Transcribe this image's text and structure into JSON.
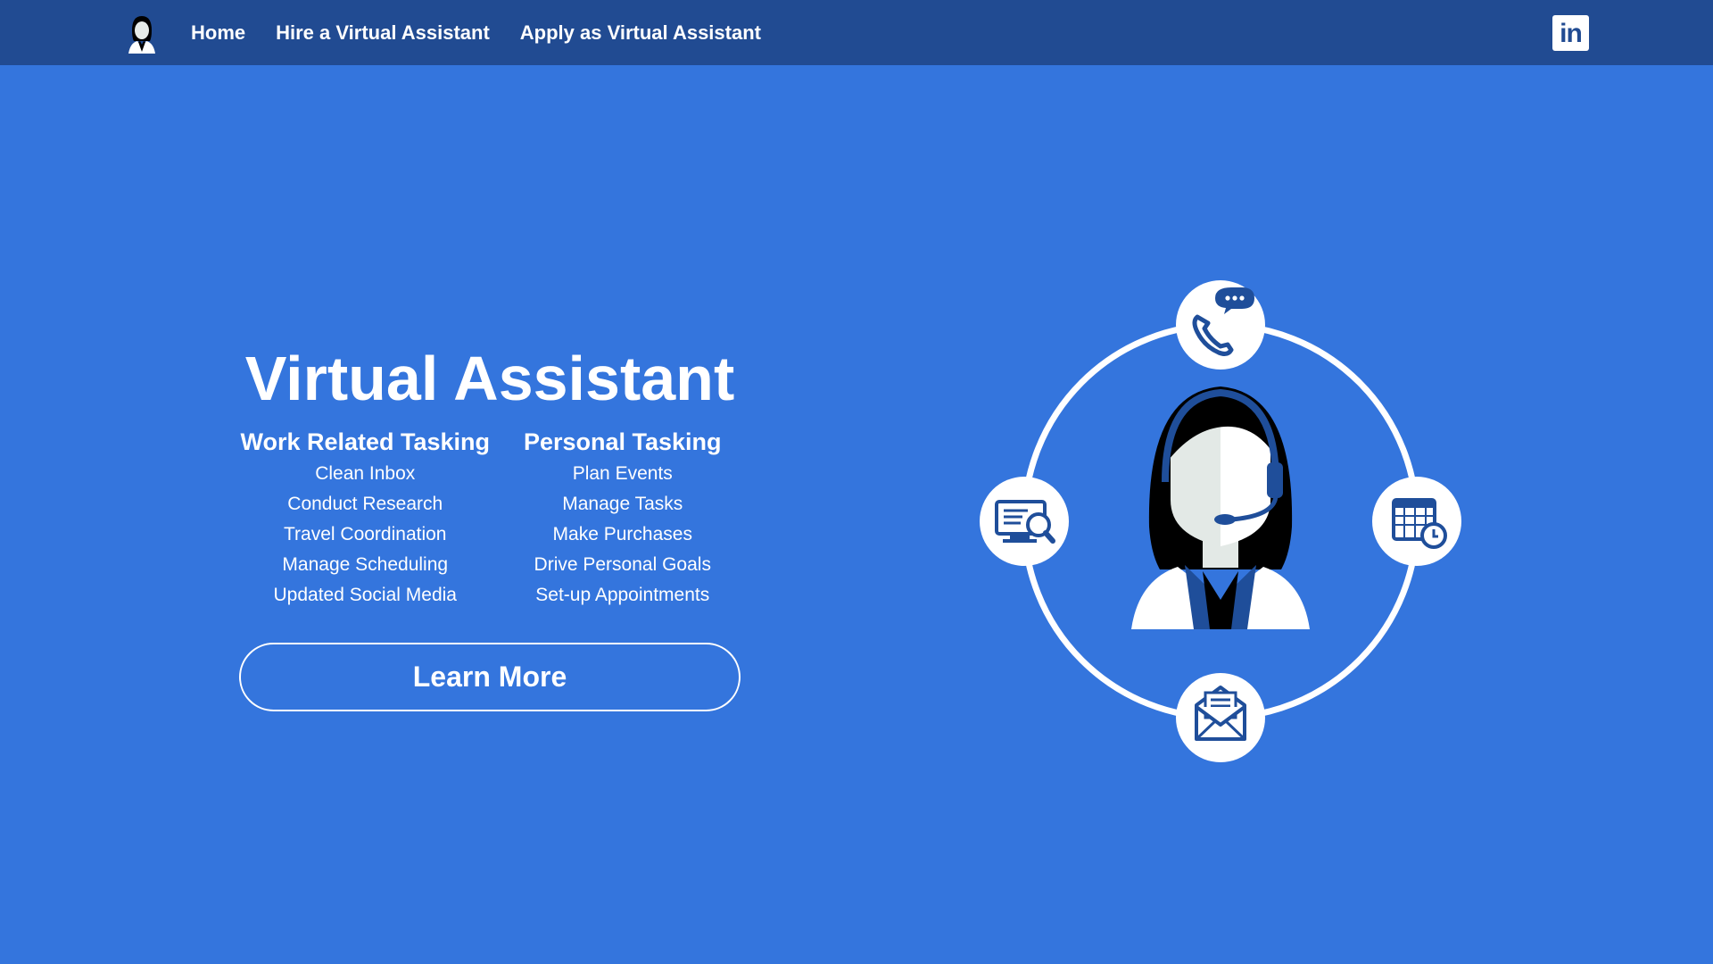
{
  "nav": {
    "links": [
      {
        "label": "Home"
      },
      {
        "label": "Hire a Virtual Assistant"
      },
      {
        "label": "Apply as Virtual Assistant"
      }
    ],
    "logo_icon": "assistant-avatar-icon",
    "social_icon": "linkedin-icon",
    "social_label": "in"
  },
  "hero": {
    "title": "Virtual Assistant",
    "work": {
      "heading": "Work Related Tasking",
      "items": [
        "Clean Inbox",
        "Conduct Research",
        "Travel Coordination",
        "Manage Scheduling",
        "Updated Social Media"
      ]
    },
    "personal": {
      "heading": "Personal Tasking",
      "items": [
        "Plan Events",
        "Manage Tasks",
        "Make Purchases",
        "Drive Personal Goals",
        "Set-up Appointments"
      ]
    },
    "cta_label": "Learn More"
  },
  "illustration": {
    "icons": [
      "phone-chat-icon",
      "monitor-search-icon",
      "calendar-clock-icon",
      "envelope-icon",
      "assistant-headset-icon"
    ]
  },
  "colors": {
    "background": "#3475dd",
    "navbar": "#214b92",
    "text": "#ffffff",
    "accent_dark": "#1f4e9a"
  }
}
